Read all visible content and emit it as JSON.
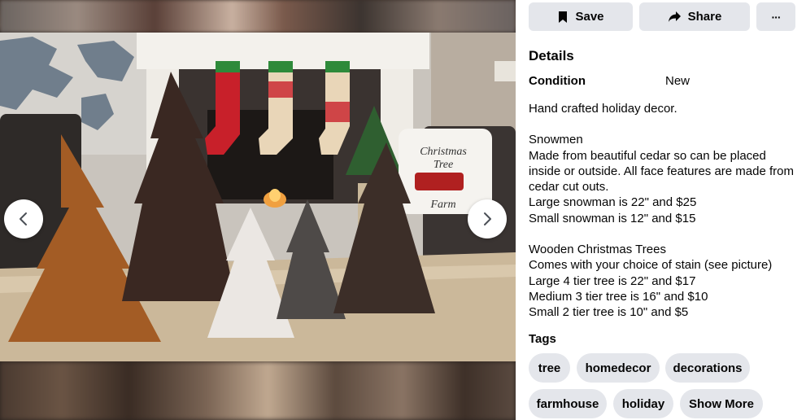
{
  "actions": {
    "save_label": "Save",
    "share_label": "Share",
    "more_label": "···"
  },
  "details": {
    "heading": "Details",
    "condition_label": "Condition",
    "condition_value": "New"
  },
  "description": {
    "intro": "Hand crafted holiday decor.",
    "snowmen_title": "Snowmen",
    "snowmen_body": "Made from beautiful cedar so can be placed inside or outside. All face features are made from cedar cut outs.",
    "snowman_large": "Large snowman is 22\" and $25",
    "snowman_small": "Small snowman is 12\" and $15",
    "trees_title": "Wooden Christmas Trees",
    "trees_stain": "Comes with your choice of stain (see picture)",
    "tree_large": "Large 4 tier tree is 22\" and $17",
    "tree_medium": "Medium 3 tier tree is 16\" and $10",
    "tree_small": "Small 2 tier tree is 10\" and $5"
  },
  "tags": {
    "heading": "Tags",
    "items": [
      "tree",
      "homedecor",
      "decorations",
      "farmhouse",
      "holiday"
    ],
    "show_more": "Show More"
  },
  "photo": {
    "pillow_text_1": "Christmas",
    "pillow_text_2": "Tree",
    "pillow_text_3": "Farm"
  },
  "icons": {
    "prev": "chevron-left-icon",
    "next": "chevron-right-icon",
    "save": "bookmark-icon",
    "share": "share-arrow-icon"
  },
  "colors": {
    "chip_bg": "#e4e6eb",
    "text": "#050505"
  }
}
